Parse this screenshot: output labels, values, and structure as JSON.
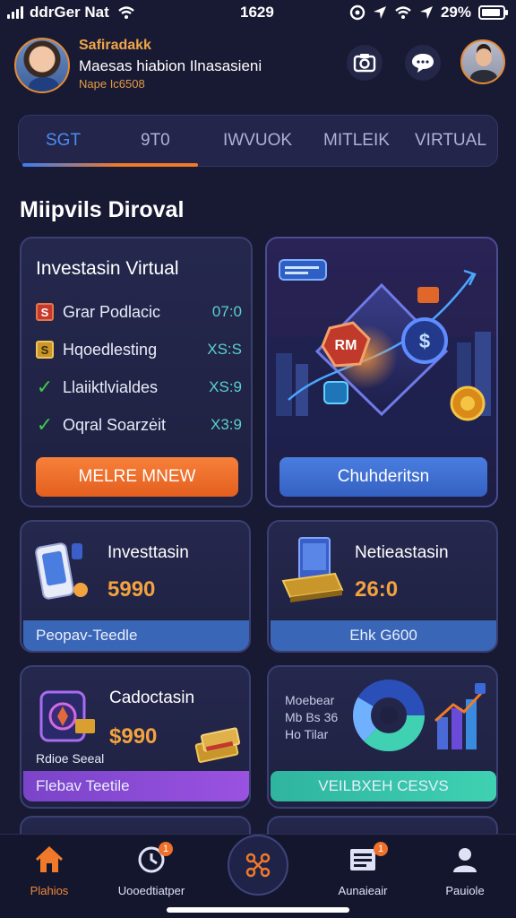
{
  "status_bar": {
    "carrier": "ddrGer Nat",
    "time": "1629",
    "battery": "29%"
  },
  "header": {
    "user_name": "Safiradakk",
    "user_subtitle": "Maesas hiabion Ilnasasieni",
    "user_meta": "Nape Ic6508"
  },
  "tabs": [
    {
      "label": "SGT",
      "active": true
    },
    {
      "label": "9T0",
      "active": false
    },
    {
      "label": "IWVUOK",
      "active": false
    },
    {
      "label": "MITLEIK",
      "active": false
    },
    {
      "label": "VIRTUAL",
      "active": false
    }
  ],
  "section_title": "Miipvils Diroval",
  "virtual_card": {
    "title": "Investasin Virtual",
    "items": [
      {
        "label": "Grar Podlacic",
        "value": "07:0",
        "icon": "red-square-icon"
      },
      {
        "label": "Hqoedlesting",
        "value": "XS:S",
        "icon": "gold-square-icon"
      },
      {
        "label": "Llaiiktlvialdes",
        "value": "XS:9",
        "icon": "check-icon"
      },
      {
        "label": "Oqral Soarzėit",
        "value": "X3:9",
        "icon": "check-icon"
      }
    ],
    "button": "MELRE MNEW"
  },
  "hero_card": {
    "badge_text": "RM",
    "button": "Chuhderitsn"
  },
  "small_cards": [
    {
      "title": "Investtasin",
      "amount": "5990",
      "bar": "Peopav-Teedle"
    },
    {
      "title": "Netieastasin",
      "amount": "26:0",
      "bar": "Ehk G600"
    },
    {
      "title": "Cadoctasin",
      "amount": "$990",
      "small": "Rdioe Seeal",
      "bar": "Flebav Teetile"
    },
    {
      "title": "",
      "text": "Moebear\nMb Bs 36\nHo Tilar",
      "bar": "VEILBXEH CESVS"
    }
  ],
  "bottom_nav": [
    {
      "label": "Plahios",
      "icon": "home-icon",
      "active": true
    },
    {
      "label": "Uooedtiatper",
      "icon": "clock-icon",
      "badge": "1"
    },
    {
      "label": "",
      "icon": "network-icon"
    },
    {
      "label": "Aunaieair",
      "icon": "document-icon",
      "badge": "1"
    },
    {
      "label": "Pauiole",
      "icon": "profile-icon"
    }
  ],
  "colors": {
    "background": "#181a33",
    "accent_orange": "#f07a2a",
    "accent_blue": "#4a8df3",
    "accent_teal": "#3fd1b2",
    "accent_purple": "#8a4cd8"
  }
}
